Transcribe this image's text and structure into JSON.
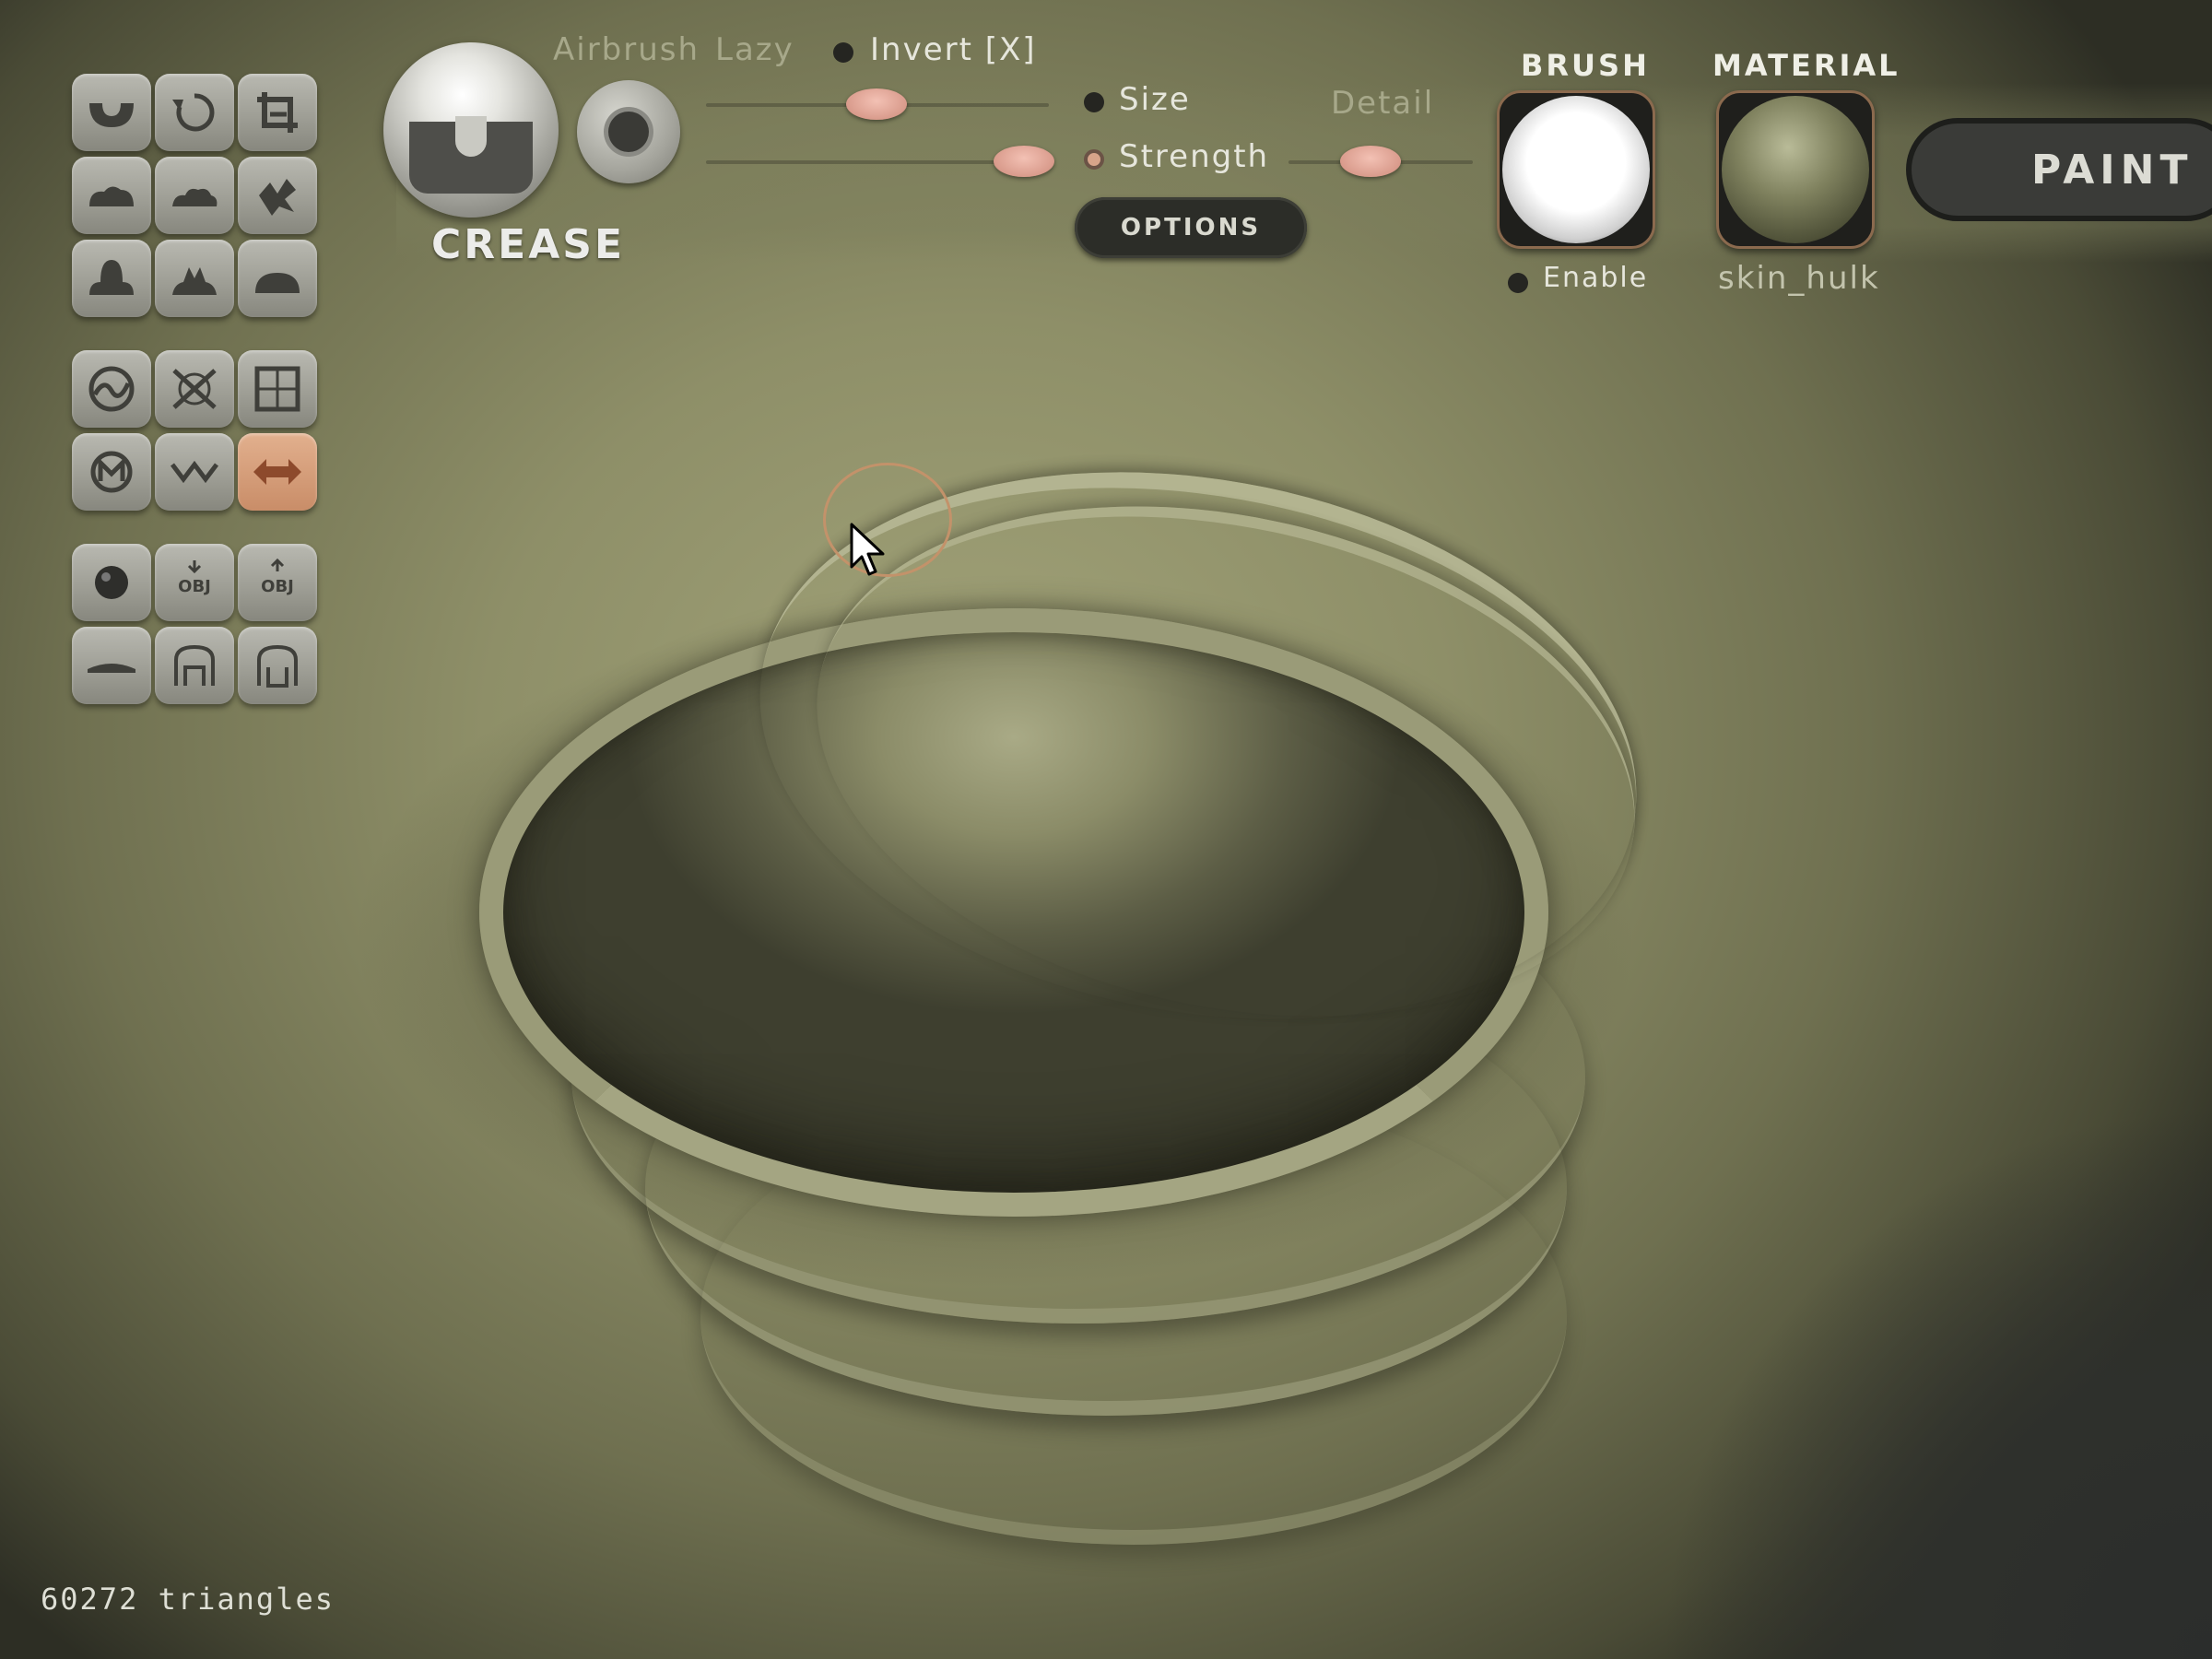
{
  "brush": {
    "name": "CREASE",
    "airbrush_label": "Airbrush",
    "lazy_label": "Lazy",
    "invert_label": "Invert [X]",
    "size_label": "Size",
    "strength_label": "Strength",
    "detail_label": "Detail",
    "options_label": "OPTIONS",
    "size_value": 0.5,
    "strength_value": 0.92,
    "detail_value": 0.45
  },
  "brush_panel": {
    "header": "BRUSH",
    "enable_label": "Enable"
  },
  "material_panel": {
    "header": "MATERIAL",
    "material_name": "skin_hulk"
  },
  "mode": {
    "paint_label": "PAINT"
  },
  "status": {
    "triangles": "60272 triangles"
  },
  "tools": [
    {
      "name": "standard-brush-icon"
    },
    {
      "name": "rotate-icon"
    },
    {
      "name": "crop-icon"
    },
    {
      "name": "smooth-brush-icon"
    },
    {
      "name": "inflate-brush-icon"
    },
    {
      "name": "grab-brush-icon"
    },
    {
      "name": "flatten-brush-icon"
    },
    {
      "name": "pinch-brush-icon"
    },
    {
      "name": "layer-brush-icon"
    },
    {
      "name": "stroke-curve-icon"
    },
    {
      "name": "delete-icon"
    },
    {
      "name": "grid-icon"
    },
    {
      "name": "symmetry-icon"
    },
    {
      "name": "wave-icon"
    },
    {
      "name": "mirror-icon"
    },
    {
      "name": "sphere-icon"
    },
    {
      "name": "import-obj-icon"
    },
    {
      "name": "export-obj-icon"
    },
    {
      "name": "ground-plane-icon"
    },
    {
      "name": "save-icon"
    },
    {
      "name": "load-icon"
    }
  ],
  "colors": {
    "accent": "#c98d68",
    "knob": "#d99b8c",
    "background": "#8e8f68"
  }
}
